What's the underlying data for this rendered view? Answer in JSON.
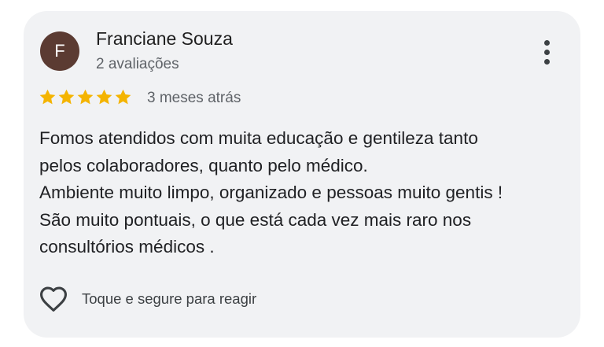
{
  "review": {
    "author_initial": "F",
    "author_name": "Franciane Souza",
    "author_reviews": "2 avaliações",
    "rating": 5,
    "rating_max": 5,
    "time_ago": "3 meses atrás",
    "text_lines": [
      "Fomos atendidos com muita educação e gentileza tanto",
      "pelos colaboradores, quanto pelo médico.",
      "Ambiente muito limpo, organizado e pessoas muito gentis !",
      "São muito pontuais, o que está cada vez mais raro nos",
      "consultórios médicos ."
    ],
    "react_label": "Toque e segure para reagir"
  },
  "icons": {
    "more": "more-vert-icon",
    "star": "star-icon",
    "react": "heart-outline-icon"
  },
  "colors": {
    "card_background": "#f1f2f4",
    "avatar_background": "#5b3b32",
    "star": "#f4b400",
    "primary_text": "#202124",
    "secondary_text": "#5f6368"
  }
}
